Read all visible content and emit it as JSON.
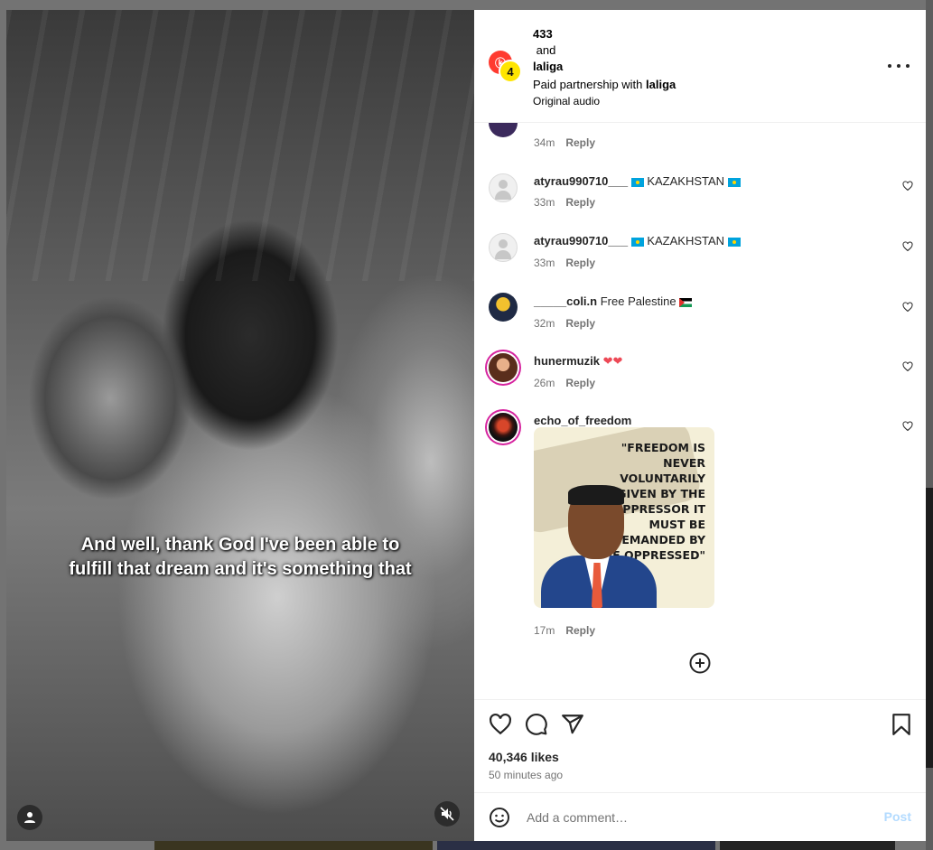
{
  "post": {
    "author1": "433",
    "joiner": "and",
    "author2": "laliga",
    "partnership_prefix": "Paid partnership with",
    "partner": "laliga",
    "audio": "Original audio",
    "avatar1_text": "ⓚ",
    "avatar2_text": "4"
  },
  "video": {
    "subtitle_line1": "And well, thank God I've been able to",
    "subtitle_line2": "fulfill that dream and it's something that"
  },
  "comments": [
    {
      "user": "",
      "text": "",
      "time": "34m",
      "reply": "Reply"
    },
    {
      "user": "atyrau990710___",
      "text": "KAZAKHSTAN",
      "time": "33m",
      "reply": "Reply"
    },
    {
      "user": "atyrau990710___",
      "text": "KAZAKHSTAN",
      "time": "33m",
      "reply": "Reply"
    },
    {
      "user": "_____coli.n",
      "text": "Free Palestine",
      "time": "32m",
      "reply": "Reply"
    },
    {
      "user": "hunermuzik",
      "text": "❤❤",
      "time": "26m",
      "reply": "Reply"
    },
    {
      "user": "echo_of_freedom",
      "text": "",
      "time": "17m",
      "reply": "Reply"
    }
  ],
  "quote_image": {
    "text": "\"FREEDOM IS NEVER VOLUNTARILY GIVEN BY THE OPPRESSOR IT MUST BE DEMANDED BY THE OPPRESSED\""
  },
  "stats": {
    "likes": "40,346 likes",
    "time_ago": "50 minutes ago"
  },
  "composer": {
    "placeholder": "Add a comment…",
    "post_label": "Post"
  },
  "colors": {
    "accent": "#0095f6",
    "post_disabled": "#b3dbff",
    "heart": "#ed4956"
  }
}
